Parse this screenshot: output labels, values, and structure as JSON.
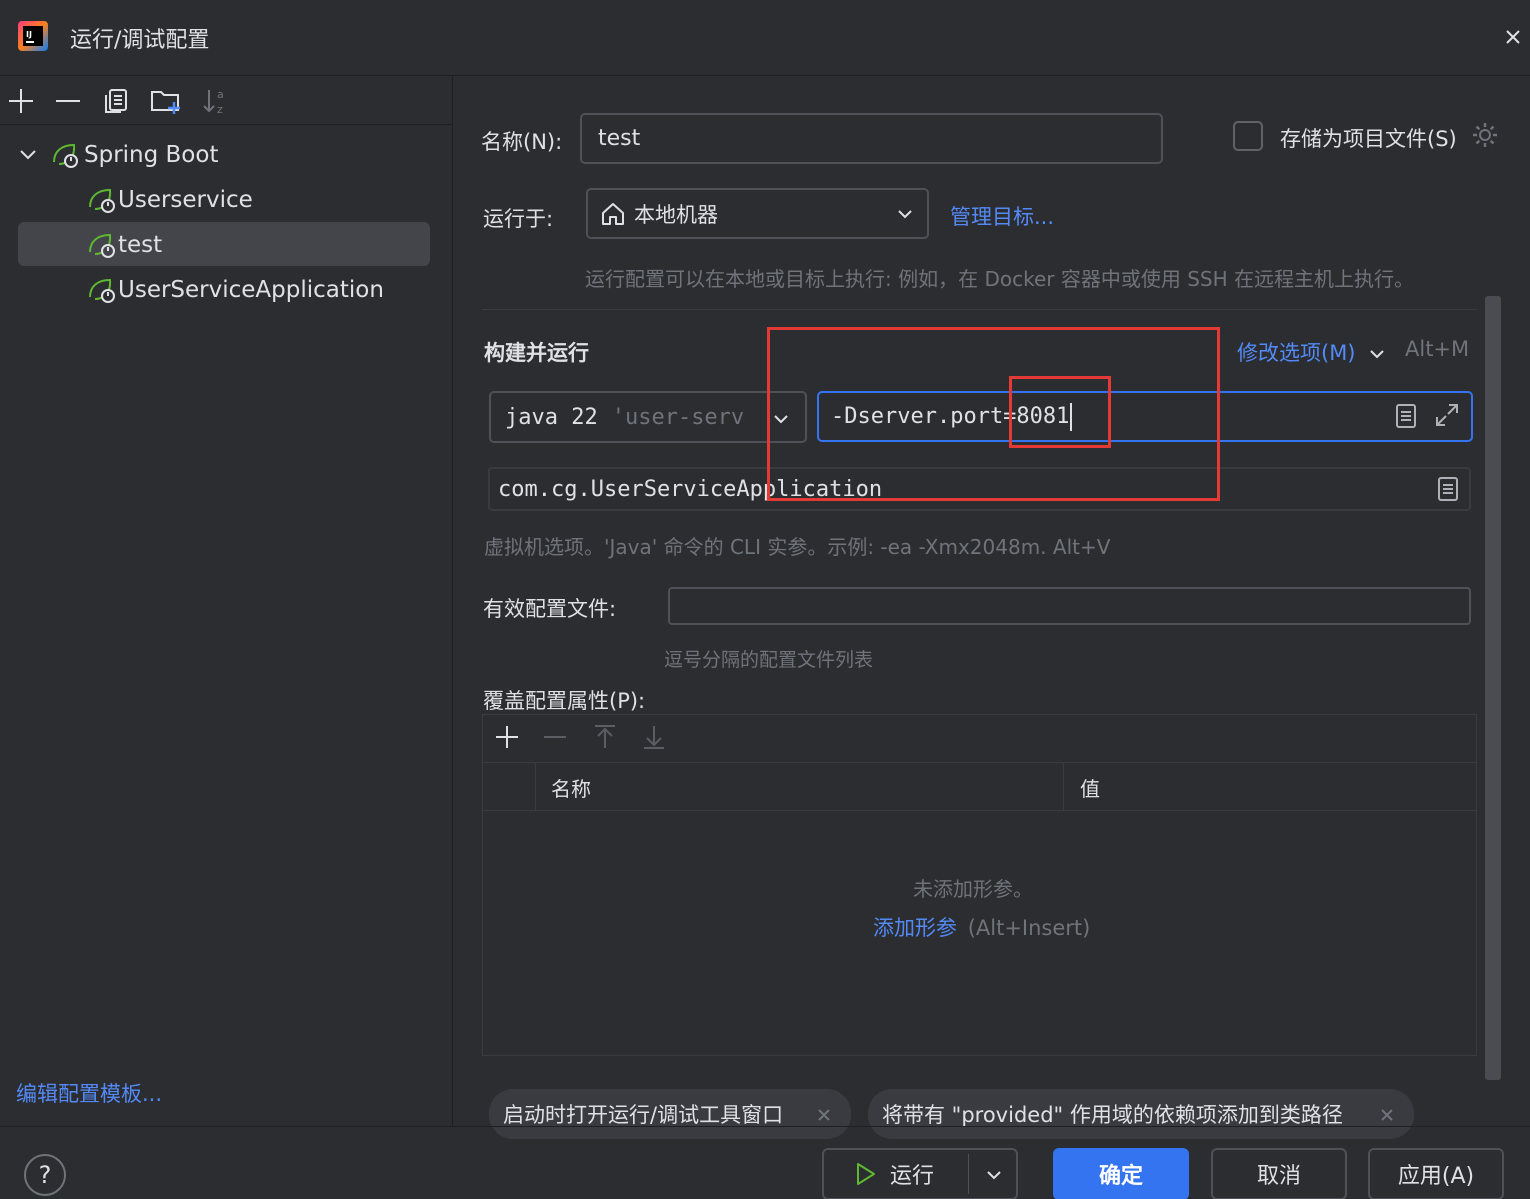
{
  "window": {
    "title": "运行/调试配置"
  },
  "tree": {
    "group_label": "Spring Boot",
    "items": [
      {
        "label": "Userservice"
      },
      {
        "label": "test"
      },
      {
        "label": "UserServiceApplication"
      }
    ],
    "selected": "test"
  },
  "left_footer": {
    "edit_templates": "编辑配置模板..."
  },
  "form": {
    "name_label": "名称(N):",
    "name_value": "test",
    "store_label": "存储为项目文件(S)",
    "run_on_label": "运行于:",
    "run_on_value": "本地机器",
    "manage_targets": "管理目标...",
    "run_on_hint": "运行配置可以在本地或目标上执行: 例如，在 Docker 容器中或使用 SSH 在远程主机上执行。",
    "section_title": "构建并运行",
    "modify_options": "修改选项(M)",
    "modify_shortcut": "Alt+M",
    "jdk_prefix": "java 22",
    "jdk_module": "'user-serv",
    "vm_options_value": "-Dserver.port=8081",
    "main_class_value": "com.cg.UserServiceApplication",
    "vm_hint": "虚拟机选项。'Java' 命令的 CLI 实参。示例: -ea -Xmx2048m. Alt+V",
    "profiles_label": "有效配置文件:",
    "profiles_value": "",
    "profiles_hint": "逗号分隔的配置文件列表",
    "override_label": "覆盖配置属性(P):"
  },
  "props_table": {
    "columns": [
      "名称",
      "值"
    ],
    "empty_text": "未添加形参。",
    "add_link": "添加形参",
    "add_shortcut": "(Alt+Insert)"
  },
  "chips": [
    {
      "label": "启动时打开运行/调试工具窗口"
    },
    {
      "label": "将带有 \"provided\" 作用域的依赖项添加到类路径"
    }
  ],
  "footer": {
    "help": "?",
    "run": "运行",
    "ok": "确定",
    "cancel": "取消",
    "apply": "应用(A)"
  },
  "colors": {
    "accent": "#3574f0",
    "link": "#548af7",
    "spring_green": "#5fb832",
    "annotation_red": "#e53935"
  }
}
